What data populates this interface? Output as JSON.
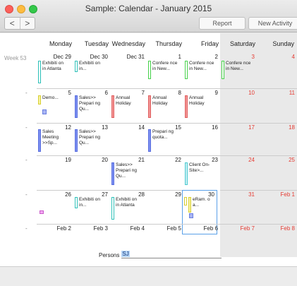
{
  "window": {
    "title": "Sample: Calendar - January 2015"
  },
  "toolbar": {
    "back": "<",
    "forward": ">",
    "report": "Report",
    "new_activity": "New Activity"
  },
  "calendar": {
    "week_label": "Week 53",
    "week_dash": "-",
    "days": [
      "Monday",
      "Tuesday",
      "Wednesday",
      "Thursday",
      "Friday",
      "Saturday",
      "Sunday"
    ],
    "weeks": [
      [
        "Dec 29",
        "Dec 30",
        "Dec 31",
        "1",
        "2",
        "3",
        "4"
      ],
      [
        "5",
        "6",
        "7",
        "8",
        "9",
        "10",
        "11"
      ],
      [
        "12",
        "13",
        "14",
        "15",
        "16",
        "17",
        "18"
      ],
      [
        "19",
        "20",
        "21",
        "22",
        "23",
        "24",
        "25"
      ],
      [
        "26",
        "27",
        "28",
        "29",
        "30",
        "31",
        "Feb 1"
      ],
      [
        "Feb 2",
        "Feb 3",
        "Feb 4",
        "Feb 5",
        "Feb 6",
        "Feb 7",
        "Feb 8"
      ]
    ],
    "events": {
      "w0_mon": "Exhibiti on in Atlanta",
      "w0_tue": "Exhibiti on in...",
      "w0_thu": "Confere nce in New...",
      "w0_fri": "Confere nce in New...",
      "w0_sat": "Confere nce in New...",
      "w1_mon": "Demo...",
      "w1_tue": "Sales>> Prepari ng Qu...",
      "w1_wed": "Annual Holiday",
      "w1_thu": "Annual Holiday",
      "w1_fri": "Annual Holiday",
      "w2_mon": "Sales Meeting >>Sp...",
      "w2_tue": "Sales>> Prepari ng Qu...",
      "w2_thu": "Prepari ng quota...",
      "w3_wed": "Sales>> Prepari ng Qu...",
      "w3_fri": "Client On- Site>...",
      "w4_tue": "Exhibiti on in...",
      "w4_wed": "Exhibiti on in Atlanta",
      "w4_fri": "eRam. o a..."
    }
  },
  "persons": {
    "label": "Persons",
    "value": "SJ"
  }
}
